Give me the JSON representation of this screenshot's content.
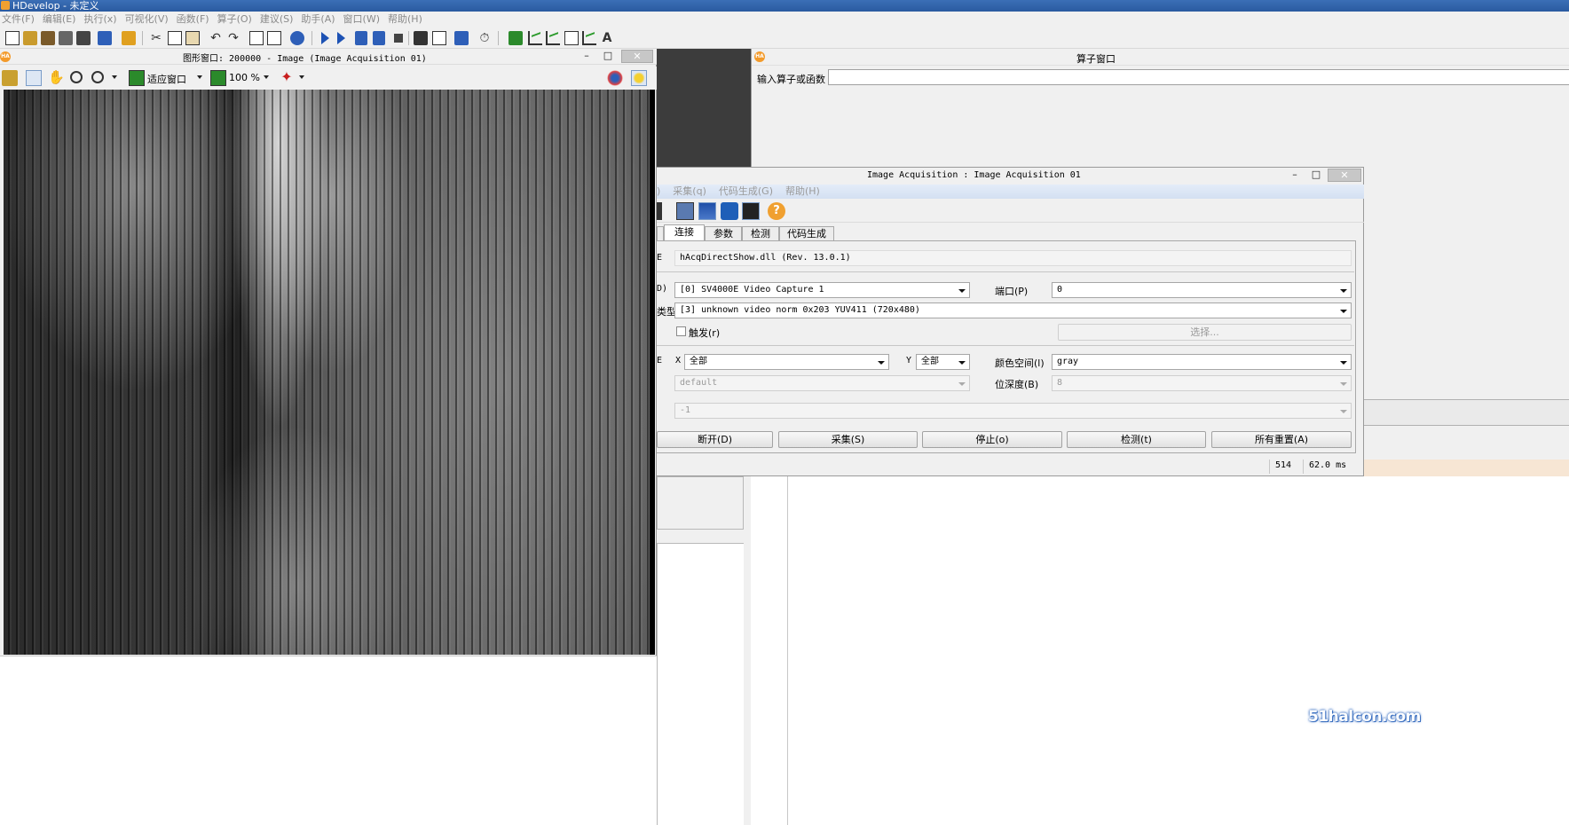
{
  "window": {
    "title": "HDevelop - 未定义"
  },
  "menubar": [
    "文件(F)",
    "编辑(E)",
    "执行(x)",
    "可视化(V)",
    "函数(F)",
    "算子(O)",
    "建议(S)",
    "助手(A)",
    "窗口(W)",
    "帮助(H)"
  ],
  "graphics": {
    "title": "图形窗口: 200000 - Image (Image Acquisition 01)",
    "fit_label": "适应窗口",
    "zoom_label": "100 %"
  },
  "operator": {
    "title": "算子窗口",
    "input_label": "输入算子或函数",
    "input_value": ""
  },
  "acq": {
    "title": "Image Acquisition : Image Acquisition 01",
    "menu": [
      ")",
      "采集(q)",
      "代码生成(G)",
      "帮助(H)"
    ],
    "tabs": [
      "连接",
      "参数",
      "检测",
      "代码生成"
    ],
    "interface_prefix": "E",
    "interface_value": "hAcqDirectShow.dll (Rev. 13.0.1)",
    "device_prefix": "D)",
    "device_value": "[0] SV4000E Video Capture 1",
    "port_label": "端口(P)",
    "port_value": "0",
    "camtype_prefix": "类型",
    "camtype_value": "[3] unknown video norm 0x203 YUV411 (720x480)",
    "trigger_label": "触发(r)",
    "select_button": "选择...",
    "res_prefix": "E",
    "x_label": "X",
    "x_value": "全部",
    "y_label": "Y",
    "y_value": "全部",
    "colorspace_label": "颜色空间(l)",
    "colorspace_value": "gray",
    "field_value": "default",
    "bitdepth_label": "位深度(B)",
    "bitdepth_value": "8",
    "line_value": "-1",
    "buttons": [
      "断开(D)",
      "采集(S)",
      "停止(o)",
      "检测(t)",
      "所有重置(A)"
    ],
    "status_value": "514",
    "status_time": "62.0 ms"
  },
  "watermark": "51halcon.com"
}
